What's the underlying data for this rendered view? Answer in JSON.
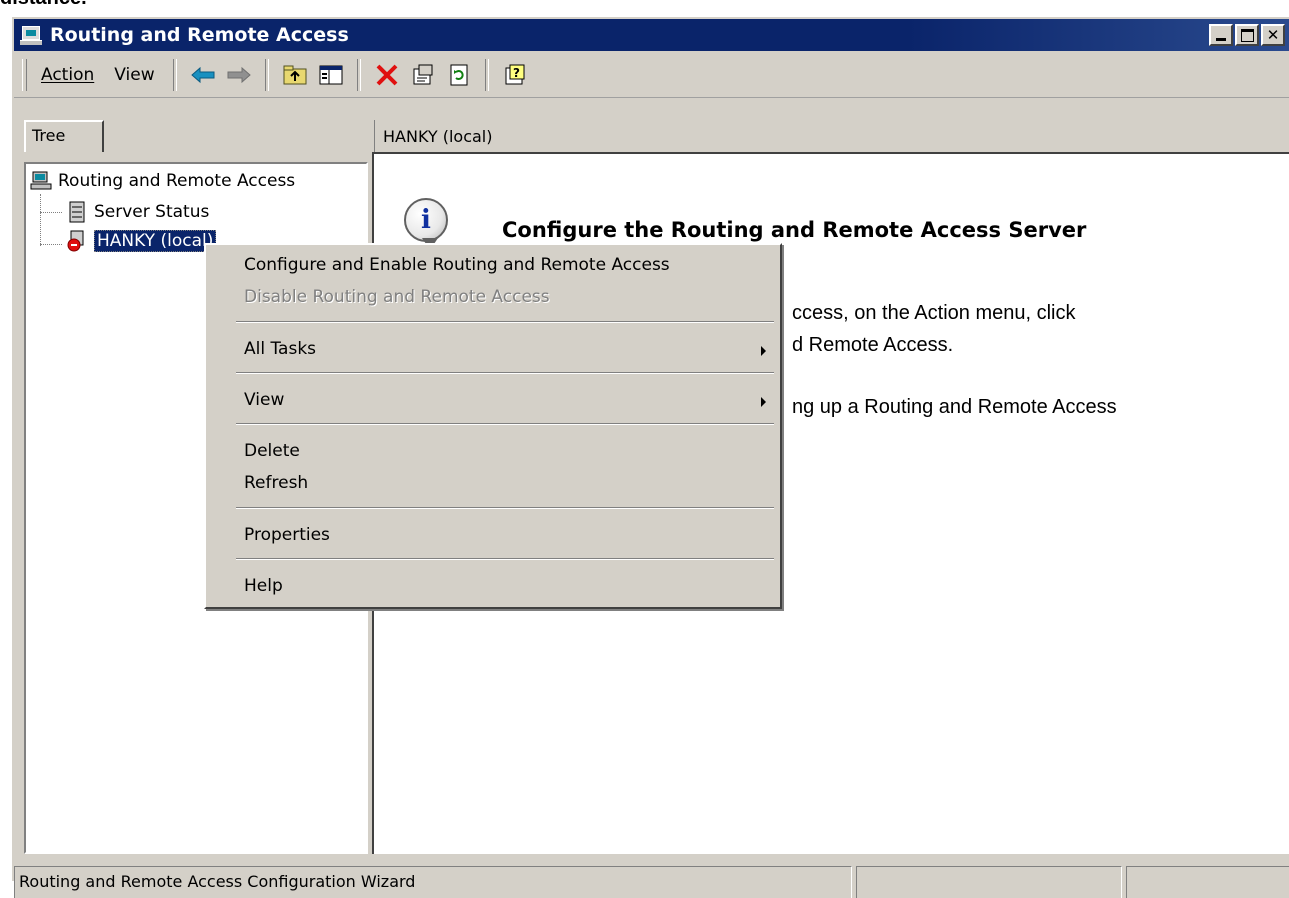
{
  "page_caption": "distance.",
  "window": {
    "title": "Routing and Remote Access"
  },
  "toolbar": {
    "menu_action": "Action",
    "menu_view": "View"
  },
  "tree_tab": "Tree",
  "right_header": "HANKY (local)",
  "tree": {
    "root": "Routing and Remote Access",
    "items": [
      {
        "label": "Server Status"
      },
      {
        "label": "HANKY (local)"
      }
    ]
  },
  "content": {
    "title": "Configure the Routing and Remote Access Server",
    "line1": "ccess, on the Action menu, click",
    "line2": "d Remote Access.",
    "line3": "ng up a Routing and Remote Access"
  },
  "context_menu": {
    "items": [
      {
        "label": "Configure and Enable Routing and Remote Access",
        "disabled": false
      },
      {
        "label": "Disable Routing and Remote Access",
        "disabled": true
      },
      {
        "label": "All Tasks",
        "submenu": true
      },
      {
        "label": "View",
        "submenu": true
      },
      {
        "label": "Delete"
      },
      {
        "label": "Refresh"
      },
      {
        "label": "Properties"
      },
      {
        "label": "Help"
      }
    ]
  },
  "statusbar": {
    "text": "Routing and Remote Access Configuration Wizard"
  },
  "colors": {
    "titlebar": "#0a246a",
    "face": "#d4d0c8",
    "selection": "#0a246a",
    "delete_icon": "#e01010",
    "nav_arrow": "#1890c0"
  }
}
